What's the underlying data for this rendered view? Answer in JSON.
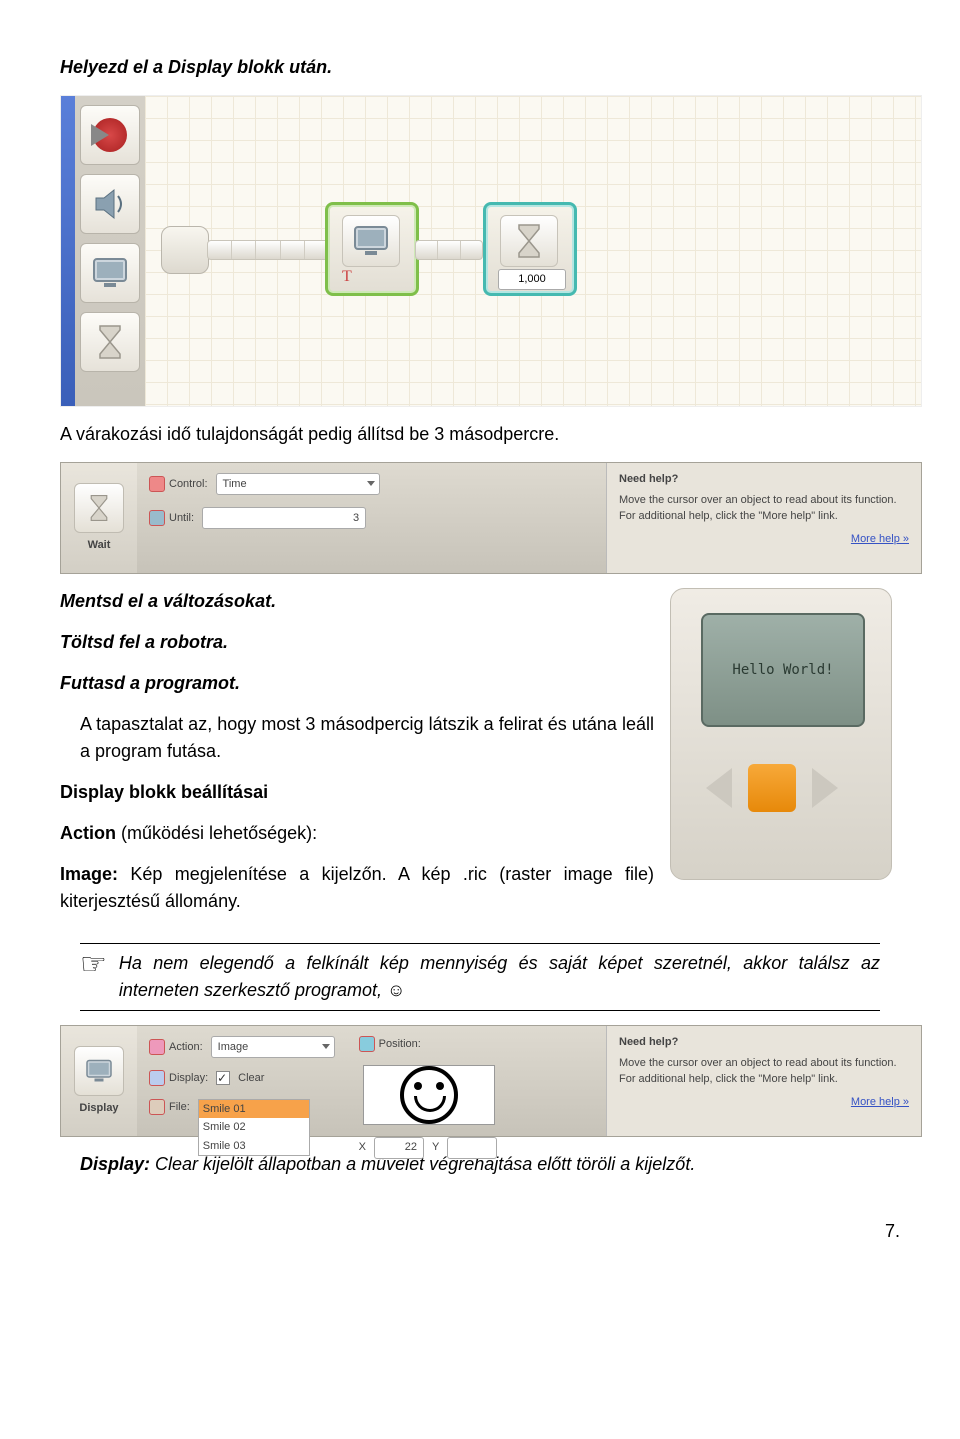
{
  "heading1": "Helyezd el a Display blokk után.",
  "canvas": {
    "wait_value": "1,000",
    "text_tag": "T"
  },
  "para1": "A várakozási idő tulajdonságát pedig állítsd be 3 másodpercre.",
  "config1": {
    "left_label": "Wait",
    "row1_label": "Control:",
    "row1_value": "Time",
    "row2_label": "Until:",
    "row2_value": "3",
    "help_title": "Need help?",
    "help_text": "Move the cursor over an object to read about its function. For additional help, click the \"More help\" link.",
    "help_link": "More help »"
  },
  "step_save": "Mentsd el a változásokat.",
  "step_upload": "Töltsd fel a robotra.",
  "step_run": "Futtasd a programot.",
  "para2": "A tapasztalat az, hogy most 3 másodpercig látszik a felirat és utána leáll a program futása.",
  "section_title": "Display blokk beállításai",
  "para_action_label": "Action",
  "para_action_text": " (működési lehetőségek):",
  "para_image_label": "Image:",
  "para_image_text": " Kép megjelenítése a kijelzőn. A kép .ric (raster image file) kiterjesztésű állomány.",
  "brick_text": "Hello World!",
  "hand_note": "Ha nem elegendő a felkínált kép mennyiség és saját képet szeretnél, akkor találsz az interneten szerkesztő programot, ☺",
  "config2": {
    "left_label": "Display",
    "action_label": "Action:",
    "action_value": "Image",
    "display_label": "Display:",
    "display_chk": "Clear",
    "file_label": "File:",
    "files": [
      "Smile 01",
      "Smile 02",
      "Smile 03"
    ],
    "position_label": "Position:",
    "x_label": "X",
    "x_value": "22",
    "y_label": "Y",
    "y_value": "",
    "help_title": "Need help?",
    "help_text": "Move the cursor over an object to read about its function. For additional help, click the \"More help\" link.",
    "help_link": "More help »"
  },
  "para_display_label": "Display:",
  "para_display_text": " Clear kijelölt állapotban a művelet végrehajtása előtt töröli a kijelzőt.",
  "page_number": "7."
}
